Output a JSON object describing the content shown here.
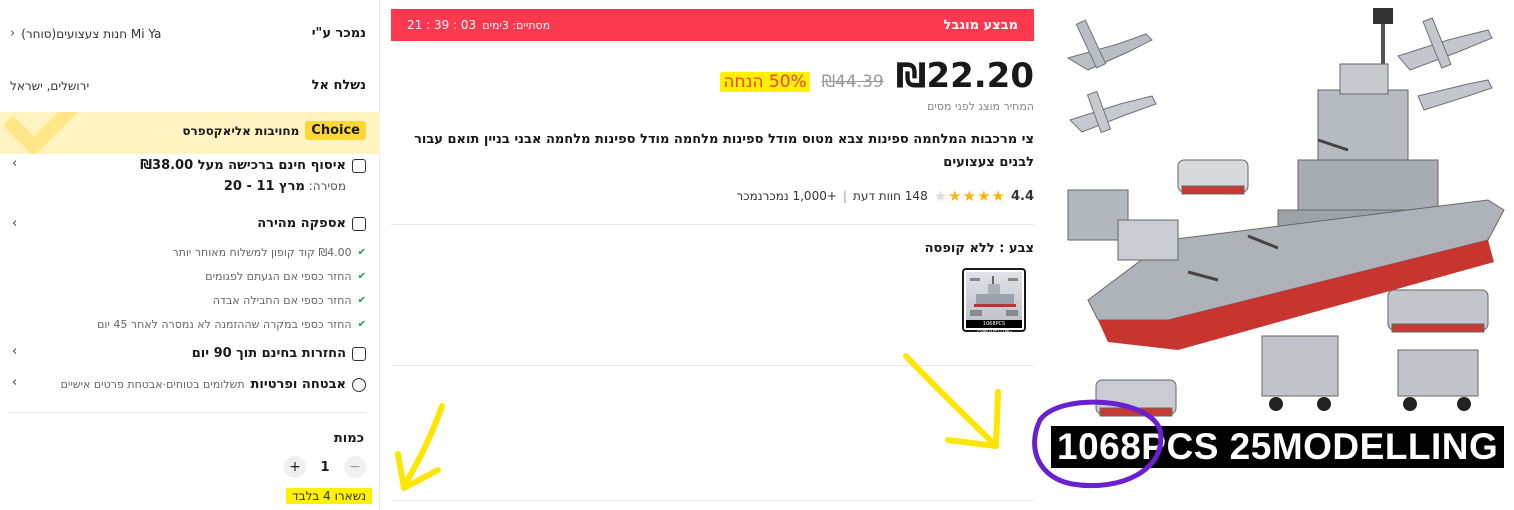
{
  "seller": {
    "label": "נמכר ע\"י",
    "store_name": "Mi Ya חנות צעצועים(סוחר)"
  },
  "ship_to": {
    "label": "נשלח אל",
    "location": "ירושלים, ישראל"
  },
  "choice": {
    "badge": "Choice",
    "text": "מחויבות אליאקספרס"
  },
  "free_shipping": {
    "title": "איסוף חינם ברכישה מעל ₪38.00",
    "delivery_label": "מסירה:",
    "delivery_date": "מרץ 11 - 20"
  },
  "fast_delivery": {
    "title": "אספקה מהירה",
    "bullets": [
      "₪4.00 קוד קופון למשלוח מאוחר יותר",
      "החזר כספי אם הגעתם לפגומים",
      "החזר כספי אם החבילה אבדה",
      "החזר כספי במקרה שההזמנה לא נמסרה לאחר 45 יום"
    ]
  },
  "returns": {
    "title": "החזרות בחינם תוך 90 יום"
  },
  "security": {
    "title": "אבטחה ופרטיות",
    "subtitle": "תשלומים בטוחים·אבטחת פרטים אישיים"
  },
  "quantity": {
    "label": "כמות",
    "value": "1",
    "minus": "−",
    "plus": "+",
    "stock_note": "נשארו 4 בלבד"
  },
  "deal": {
    "name": "מבצע מוגבל",
    "ends_label": "מסתיים: 3ימים",
    "countdown": "03 : 39 : 21"
  },
  "price": {
    "current": "₪22.20",
    "original": "₪44.39",
    "discount": "50% הנחה",
    "tax_note": "המחיר מוצג לפני מסים"
  },
  "product": {
    "title": "צי מרכבות המלחמה ספינות צבא מטוס מודל ספינות מלחמה מודל ספינות מלחמה אבני בניין תואם עבור לבנים צעצועים",
    "rating": "4.4",
    "rating_value": 4.4,
    "reviews": "148 חוות דעת",
    "sold": "+1,000 נמכרנמכר",
    "color_label": "צבע : ללא קופסה",
    "swatch_caption": "1068PCS 25MODELLING"
  },
  "image": {
    "caption": "1068PCS 25MODELLING"
  },
  "icons": {
    "chevron": "›",
    "chevron_left": "‹",
    "check": "✔",
    "star": "★"
  },
  "colors": {
    "deal_red": "#fd384f",
    "choice_yellow": "#fdd835",
    "highlight": "#fff100",
    "annotation_yellow": "#ffe600",
    "annotation_purple": "#6a1fd1"
  }
}
